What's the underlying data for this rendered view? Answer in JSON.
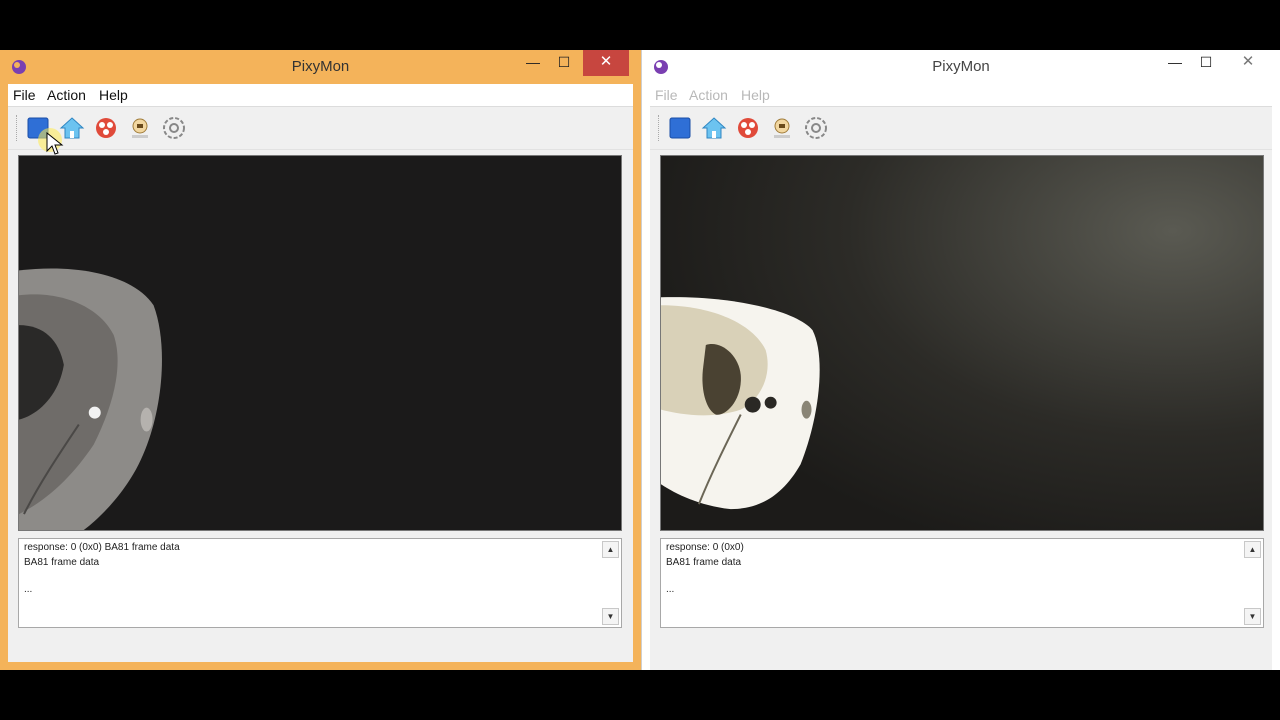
{
  "left_window": {
    "title": "PixyMon",
    "controls": {
      "minimize": "—",
      "maximize": "☐",
      "close": "✕"
    },
    "menu": [
      "File",
      "Action",
      "Help"
    ],
    "toolbar": [
      "stop-icon",
      "home-icon",
      "run-pixy-icon",
      "default-program-icon",
      "settings-icon"
    ],
    "console": {
      "lines": [
        "response: 0 (0x0) BA81 frame data",
        "BA81 frame data",
        "..."
      ]
    },
    "colors": {
      "titlebar": "#f4b35a",
      "close": "#c7463f"
    }
  },
  "right_window": {
    "title": "PixyMon",
    "controls": {
      "minimize": "—",
      "maximize": "☐",
      "close": "✕"
    },
    "menu": [
      "File",
      "Action",
      "Help"
    ],
    "toolbar": [
      "stop-icon",
      "home-icon",
      "run-pixy-icon",
      "default-program-icon",
      "settings-icon"
    ],
    "console": {
      "lines": [
        "response: 0 (0x0)",
        "BA81 frame data",
        "..."
      ]
    },
    "colors": {
      "titlebar": "#ffffff"
    }
  }
}
